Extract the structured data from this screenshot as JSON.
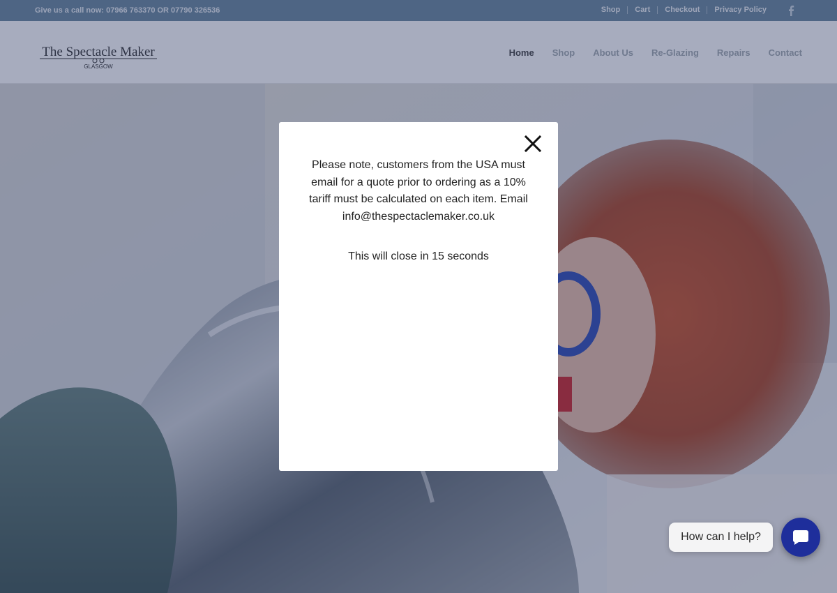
{
  "topbar": {
    "phone_text": "Give us a call now: 07966 763370 OR 07790 326536",
    "links": [
      "Shop",
      "Cart",
      "Checkout",
      "Privacy Policy"
    ],
    "social_icon": "facebook-icon"
  },
  "header": {
    "logo_title": "The Spectacle Maker",
    "logo_subtitle": "GLASGOW",
    "nav": [
      "Home",
      "Shop",
      "About Us",
      "Re-Glazing",
      "Repairs",
      "Contact"
    ],
    "active_nav": "Home"
  },
  "modal": {
    "message": "Please note, customers from the USA must email for a quote prior to ordering as a 10% tariff must be calculated on each item. Email info@thespectaclemaker.co.uk",
    "timer_text": "This will close in 15 seconds",
    "close_icon": "close-icon"
  },
  "chat": {
    "prompt": "How can I help?",
    "icon": "chat-bubble-icon"
  },
  "colors": {
    "topbar_bg": "#5d7f95",
    "chat_button": "#1e2e9b",
    "overlay": "#3c486e"
  }
}
